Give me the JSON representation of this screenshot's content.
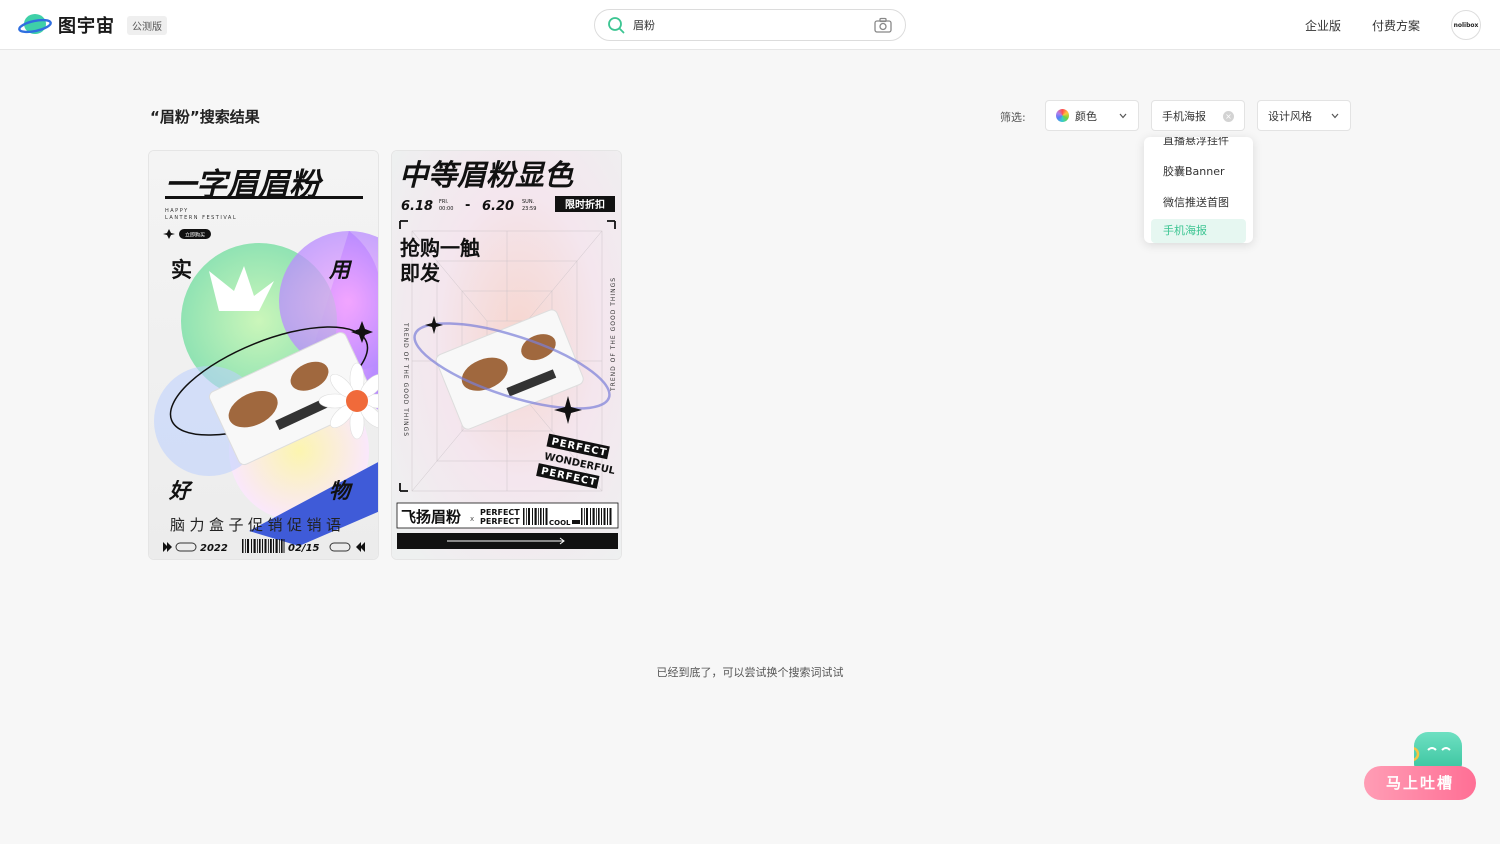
{
  "header": {
    "logo_text": "图宇宙",
    "beta": "公测版",
    "search_value": "眉粉",
    "nav": {
      "enterprise": "企业版",
      "pricing": "付费方案"
    },
    "avatar_text": "nolibox"
  },
  "results": {
    "title": "“眉粉”搜索结果",
    "filter_label": "筛选:",
    "filters": {
      "color": "颜色",
      "type": "手机海报",
      "style": "设计风格"
    },
    "dropdown": [
      "直播悬浮挂件",
      "胶囊Banner",
      "微信推送首图",
      "手机海报"
    ],
    "end_note": "已经到底了，可以尝试换个搜索词试试"
  },
  "card1": {
    "title": "一字眉眉粉",
    "sub1": "HAPPY",
    "sub2": "LANTERN FESTIVAL",
    "btn": "立即购买",
    "c1": "实",
    "c2": "用",
    "c3": "好",
    "c4": "物",
    "slogan": "脑力盒子促销促销语",
    "year": "2022",
    "date": "02/15"
  },
  "card2": {
    "title": "中等眉粉显色",
    "d1": "6.18",
    "d1a": "FRI.",
    "d1b": "00:00",
    "dash": "-",
    "d2": "6.20",
    "d2a": "SUN.",
    "d2b": "23:59",
    "promo": "限时折扣",
    "h1": "抢购一触",
    "h2": "即发",
    "side": "TREND OF THE GOOD THINGS",
    "p1": "PERFECT",
    "p2": "WONDERFUL",
    "p3": "PERFECT",
    "brand": "飞扬眉粉",
    "x": "x",
    "pf1": "PERFECT",
    "pf2": "PERFECT",
    "cool": "COOL"
  },
  "feedback": {
    "label": "马上吐槽"
  },
  "colors": {
    "accent": "#3cc592",
    "feedback_pink": "#ff6f95"
  }
}
